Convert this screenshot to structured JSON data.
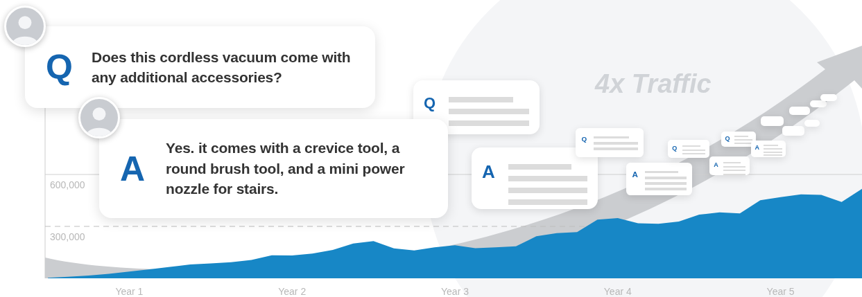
{
  "question": {
    "letter": "Q",
    "text": "Does this cordless vacuum come with any additional accessories?"
  },
  "answer": {
    "letter": "A",
    "text": "Yes. it comes with a crevice tool, a round brush tool, and a mini power nozzle for stairs."
  },
  "headline": "4x Traffic",
  "mini_cards": [
    {
      "kind": "question",
      "letter": "Q"
    },
    {
      "kind": "answer",
      "letter": "A"
    },
    {
      "kind": "question",
      "letter": "Q"
    },
    {
      "kind": "answer",
      "letter": "A"
    },
    {
      "kind": "question",
      "letter": "Q"
    },
    {
      "kind": "answer",
      "letter": "A"
    },
    {
      "kind": "question",
      "letter": "Q"
    },
    {
      "kind": "answer",
      "letter": "A"
    }
  ],
  "chart": {
    "chart_data": {
      "type": "area",
      "categories": [
        null,
        null,
        null,
        null,
        "Year 1",
        null,
        null,
        null,
        null,
        null,
        null,
        null,
        "Year 2",
        null,
        null,
        null,
        null,
        null,
        null,
        null,
        "Year 3",
        null,
        null,
        null,
        null,
        null,
        null,
        null,
        "Year 4",
        null,
        null,
        null,
        null,
        null,
        null,
        null,
        "Year 5",
        null,
        null,
        null,
        null
      ],
      "series": [
        {
          "color": "#1787c6",
          "values": [
            3000,
            9000,
            16000,
            26000,
            39000,
            52000,
            66000,
            80000,
            86000,
            93000,
            106000,
            133000,
            132000,
            143000,
            164000,
            201000,
            215000,
            173000,
            161000,
            179000,
            191000,
            174000,
            179000,
            185000,
            243000,
            261000,
            267000,
            339000,
            348000,
            318000,
            315000,
            328000,
            368000,
            381000,
            375000,
            451000,
            469000,
            485000,
            482000,
            441000,
            517000
          ]
        }
      ],
      "ylim": [
        0,
        1008000
      ],
      "ref_lines": [
        {
          "axis": "y",
          "value": 300000
        },
        {
          "axis": "y",
          "value": 600000
        }
      ],
      "yticks": [
        {
          "value": 300000,
          "label": "300,000"
        },
        {
          "value": 600000,
          "label": "600,000"
        }
      ]
    }
  }
}
